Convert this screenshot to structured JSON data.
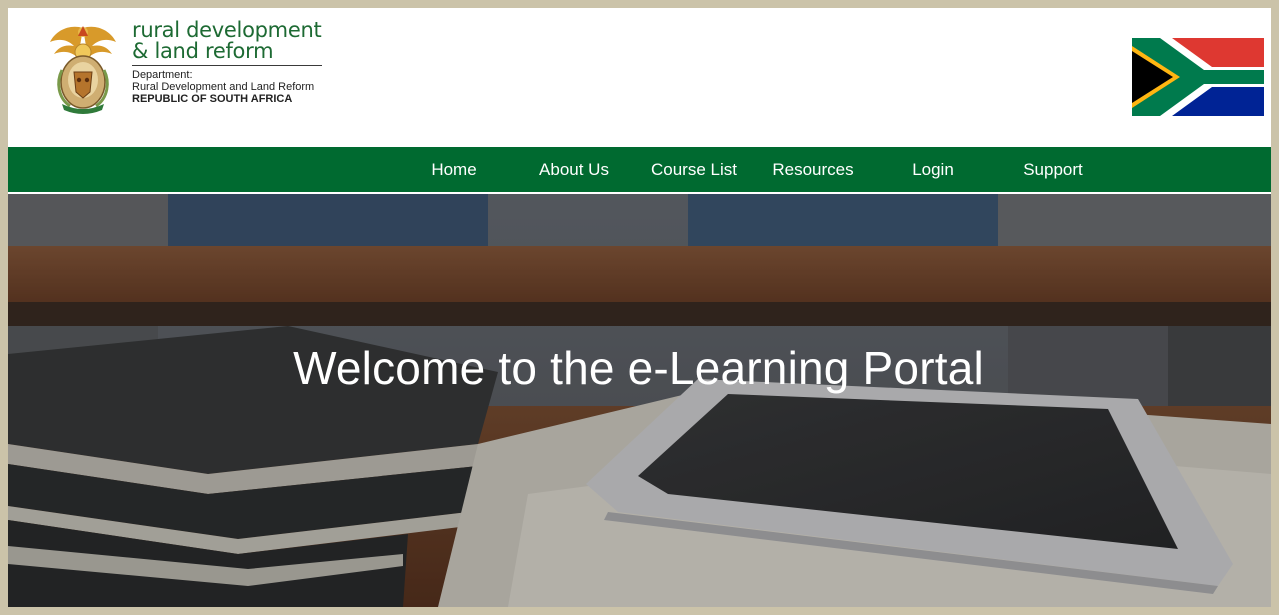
{
  "header": {
    "brand_line1": "rural development",
    "brand_line2": "& land reform",
    "dept_label": "Department:",
    "dept_name": "Rural Development and Land Reform",
    "country": "REPUBLIC OF SOUTH AFRICA",
    "crest_icon": "coat-of-arms-icon",
    "flag_icon": "south-africa-flag-icon"
  },
  "nav": {
    "items": [
      {
        "label": "Home"
      },
      {
        "label": "About Us"
      },
      {
        "label": "Course List"
      },
      {
        "label": "Resources"
      },
      {
        "label": "Login"
      },
      {
        "label": "Support"
      }
    ]
  },
  "hero": {
    "title": "Welcome to the e-Learning Portal"
  },
  "colors": {
    "brand_green": "#006a30",
    "title_green": "#1d6a33",
    "page_border": "#cbc3a9"
  }
}
